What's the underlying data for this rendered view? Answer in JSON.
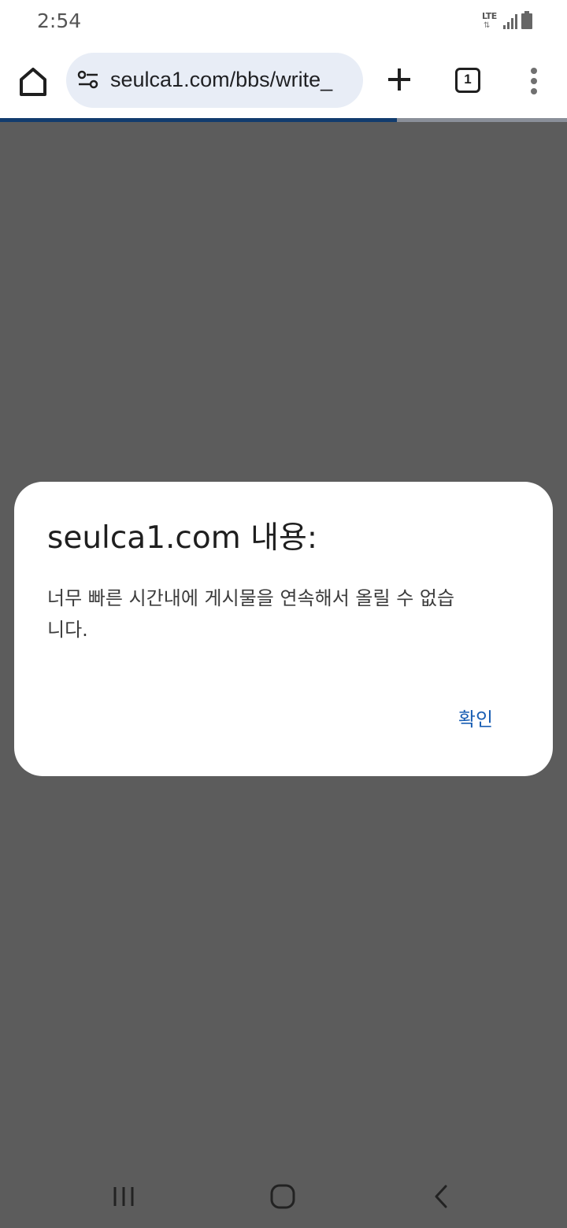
{
  "status_bar": {
    "time": "2:54",
    "network": "LTE",
    "icons": [
      "lte-icon",
      "signal-icon",
      "battery-icon"
    ]
  },
  "browser": {
    "url": "seulca1.com/bbs/write_",
    "tab_count": "1",
    "page_load_progress": 0.7
  },
  "dialog": {
    "title": "seulca1.com 내용:",
    "message": "너무 빠른 시간내에 게시물을 연속해서 올릴 수 없습니다.",
    "ok_label": "확인"
  },
  "colors": {
    "scrim": "#5c5c5c",
    "accent": "#1a5fb4",
    "url_bar_bg": "#e8edf6"
  }
}
